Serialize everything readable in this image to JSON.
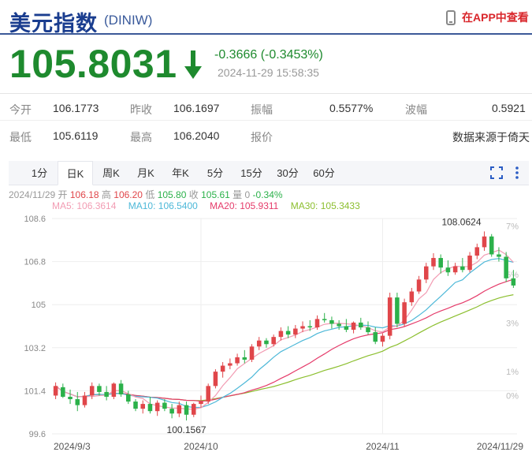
{
  "header": {
    "title": "美元指数",
    "code": "(DINIW)",
    "app_link": "在APP中查看"
  },
  "quote": {
    "price": "105.8031",
    "change": "-0.3666 (-0.3453%)",
    "timestamp": "2024-11-29 15:58:35"
  },
  "stats": {
    "row1": [
      {
        "label": "今开",
        "value": "106.1773"
      },
      {
        "label": "昨收",
        "value": "106.1697"
      },
      {
        "label": "振幅",
        "value": "0.5577%"
      },
      {
        "label": "波幅",
        "value": "0.5921"
      }
    ],
    "row2": [
      {
        "label": "最低",
        "value": "105.6119"
      },
      {
        "label": "最高",
        "value": "106.2040"
      },
      {
        "label": "报价",
        "value": ""
      },
      {
        "label": "",
        "value": "数据来源于倚天"
      }
    ]
  },
  "tabs": [
    "1分",
    "日K",
    "周K",
    "月K",
    "年K",
    "5分",
    "15分",
    "30分",
    "60分"
  ],
  "active_tab": "日K",
  "ohlc_line": {
    "date": "2024/11/29",
    "open_label": "开",
    "open": "106.18",
    "high_label": "高",
    "high": "106.20",
    "low_label": "低",
    "low": "105.80",
    "close_label": "收",
    "close": "105.61",
    "vol_label": "量",
    "vol": "0",
    "pct": "-0.34%"
  },
  "ma_legend": [
    {
      "label": "MA5: 106.3614",
      "color": "#f29cb3"
    },
    {
      "label": "MA10: 106.5400",
      "color": "#4db8d8"
    },
    {
      "label": "MA20: 105.9311",
      "color": "#e53b6a"
    },
    {
      "label": "MA30: 105.3433",
      "color": "#8cbf2f"
    }
  ],
  "colors": {
    "up": "#e0464a",
    "down": "#2bb14a",
    "title": "#1a3d8f",
    "price": "#1e8a2e"
  },
  "chart_data": {
    "type": "candlestick",
    "y_ticks": [
      "108.6",
      "106.8",
      "105",
      "103.2",
      "101.4",
      "99.6"
    ],
    "y_tick_values": [
      108.6,
      106.8,
      105,
      103.2,
      101.4,
      99.6
    ],
    "pct_ticks": [
      "7%",
      "5%",
      "3%",
      "1%",
      "0%",
      "-2%"
    ],
    "pct_tick_values": [
      7,
      5,
      3,
      1,
      0,
      -2
    ],
    "x_labels": [
      "2024/9/3",
      "2024/10",
      "2024/11",
      "2024/11/29"
    ],
    "x_label_indices": [
      0,
      20,
      45,
      63
    ],
    "ylim": [
      99.6,
      108.6
    ],
    "max_label": "108.0624",
    "max_index": 59,
    "min_label": "100.1567",
    "min_index": 18,
    "candles": [
      [
        101.2,
        101.75,
        101.05,
        101.6
      ],
      [
        101.55,
        101.7,
        101.1,
        101.15
      ],
      [
        101.15,
        101.45,
        100.85,
        101.05
      ],
      [
        101.05,
        101.35,
        100.55,
        100.8
      ],
      [
        100.8,
        101.35,
        100.7,
        101.2
      ],
      [
        101.2,
        101.75,
        101.05,
        101.6
      ],
      [
        101.6,
        101.7,
        101.2,
        101.35
      ],
      [
        101.35,
        101.6,
        101.0,
        101.15
      ],
      [
        101.15,
        101.75,
        101.05,
        101.7
      ],
      [
        101.7,
        101.85,
        101.15,
        101.25
      ],
      [
        101.25,
        101.4,
        100.85,
        100.95
      ],
      [
        100.95,
        101.05,
        100.55,
        100.65
      ],
      [
        100.65,
        101.0,
        100.45,
        100.85
      ],
      [
        100.85,
        101.15,
        100.45,
        100.55
      ],
      [
        100.55,
        101.0,
        100.35,
        100.9
      ],
      [
        100.9,
        101.05,
        100.55,
        100.65
      ],
      [
        100.65,
        100.85,
        100.25,
        100.45
      ],
      [
        100.45,
        100.95,
        100.3,
        100.8
      ],
      [
        100.8,
        100.95,
        100.16,
        100.4
      ],
      [
        100.4,
        100.9,
        100.3,
        100.85
      ],
      [
        100.85,
        101.2,
        100.7,
        100.95
      ],
      [
        100.95,
        101.7,
        100.85,
        101.6
      ],
      [
        101.6,
        102.3,
        101.5,
        102.2
      ],
      [
        102.2,
        102.6,
        101.95,
        102.45
      ],
      [
        102.45,
        102.75,
        102.3,
        102.55
      ],
      [
        102.55,
        102.95,
        102.45,
        102.8
      ],
      [
        102.8,
        103.1,
        102.55,
        102.7
      ],
      [
        102.7,
        103.35,
        102.6,
        103.25
      ],
      [
        103.25,
        103.65,
        103.1,
        103.5
      ],
      [
        103.5,
        103.6,
        103.2,
        103.35
      ],
      [
        103.35,
        103.75,
        103.25,
        103.65
      ],
      [
        103.65,
        104.05,
        103.5,
        103.9
      ],
      [
        103.9,
        104.1,
        103.6,
        103.75
      ],
      [
        103.75,
        104.15,
        103.6,
        104.0
      ],
      [
        104.0,
        104.3,
        103.85,
        104.1
      ],
      [
        104.1,
        104.35,
        103.9,
        104.05
      ],
      [
        104.05,
        104.55,
        103.95,
        104.4
      ],
      [
        104.4,
        104.65,
        104.25,
        104.35
      ],
      [
        104.35,
        104.5,
        104.0,
        104.2
      ],
      [
        104.2,
        104.35,
        103.95,
        104.1
      ],
      [
        104.1,
        104.4,
        103.85,
        103.95
      ],
      [
        103.95,
        104.3,
        103.8,
        104.25
      ],
      [
        104.25,
        104.45,
        103.95,
        104.05
      ],
      [
        104.05,
        104.3,
        103.75,
        103.85
      ],
      [
        103.85,
        104.05,
        103.35,
        103.45
      ],
      [
        103.45,
        103.8,
        103.25,
        103.7
      ],
      [
        103.7,
        105.5,
        103.55,
        105.3
      ],
      [
        105.3,
        105.5,
        104.05,
        104.2
      ],
      [
        104.2,
        105.25,
        104.1,
        105.1
      ],
      [
        105.1,
        105.7,
        104.95,
        105.55
      ],
      [
        105.55,
        106.2,
        105.45,
        106.05
      ],
      [
        106.05,
        106.75,
        105.9,
        106.6
      ],
      [
        106.6,
        107.15,
        106.45,
        106.95
      ],
      [
        106.95,
        107.1,
        106.3,
        106.55
      ],
      [
        106.55,
        106.85,
        106.2,
        106.35
      ],
      [
        106.35,
        106.75,
        106.25,
        106.6
      ],
      [
        106.6,
        106.95,
        106.35,
        106.45
      ],
      [
        106.45,
        107.2,
        106.35,
        107.05
      ],
      [
        107.05,
        107.55,
        106.9,
        107.4
      ],
      [
        107.4,
        108.06,
        107.25,
        107.85
      ],
      [
        107.85,
        107.95,
        107.0,
        107.1
      ],
      [
        107.1,
        107.4,
        106.8,
        107.0
      ],
      [
        107.0,
        107.2,
        105.95,
        106.1
      ],
      [
        106.1,
        106.45,
        105.7,
        105.8
      ]
    ]
  }
}
